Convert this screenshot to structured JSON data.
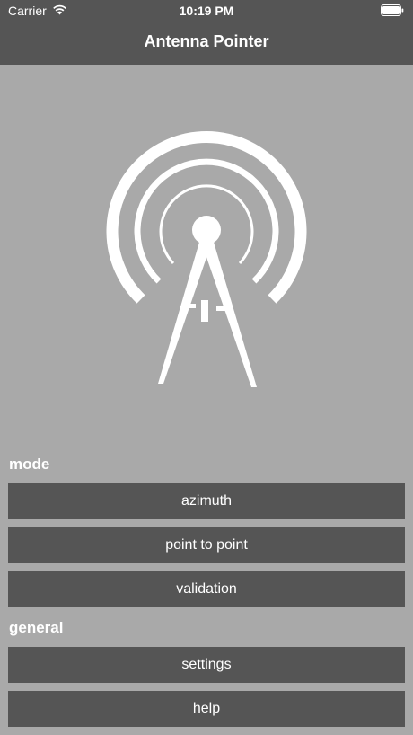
{
  "status_bar": {
    "carrier": "Carrier",
    "time": "10:19 PM"
  },
  "nav": {
    "title": "Antenna Pointer"
  },
  "logo": {
    "icon": "antenna-tower-icon"
  },
  "sections": {
    "mode": {
      "label": "mode",
      "buttons": [
        "azimuth",
        "point to point",
        "validation"
      ]
    },
    "general": {
      "label": "general",
      "buttons": [
        "settings",
        "help"
      ]
    }
  },
  "colors": {
    "background": "#a9a9a9",
    "bar": "#555555",
    "button": "#555555",
    "foreground": "#ffffff"
  }
}
